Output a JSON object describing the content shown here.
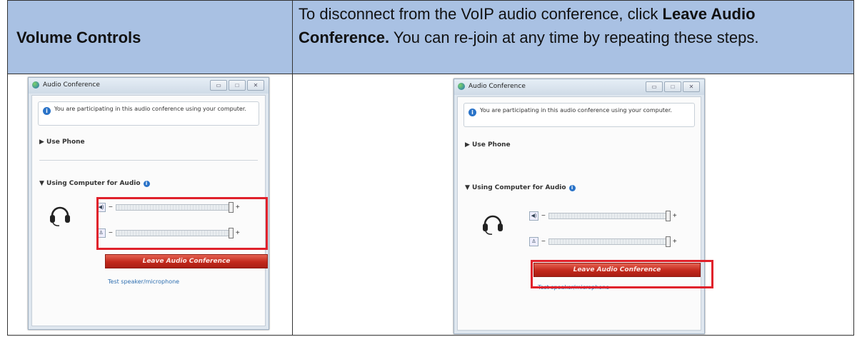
{
  "header": {
    "left_title": "Volume Controls",
    "instr_pre": "To disconnect from the VoIP audio conference, click ",
    "instr_bold": "Leave Audio Conference.",
    "instr_post": " You can re-join at any time by repeating these steps."
  },
  "window": {
    "title": "Audio Conference",
    "info_text": "You are participating in this audio conference using your computer.",
    "use_phone": "▶ Use Phone",
    "using_computer": "▼ Using Computer for Audio",
    "leave_button": "Leave Audio Conference",
    "test_link": "Test speaker/microphone",
    "minus": "−",
    "plus": "+",
    "info_glyph": "i",
    "help_glyph": "i",
    "speaker_glyph": "◀)",
    "mic_glyph": "♙",
    "minimize_glyph": "▭",
    "maximize_glyph": "□",
    "close_glyph": "✕"
  },
  "colors": {
    "header_bg": "#a9c1e3",
    "highlight": "#e0212b",
    "leave_button": "#c2281c"
  }
}
